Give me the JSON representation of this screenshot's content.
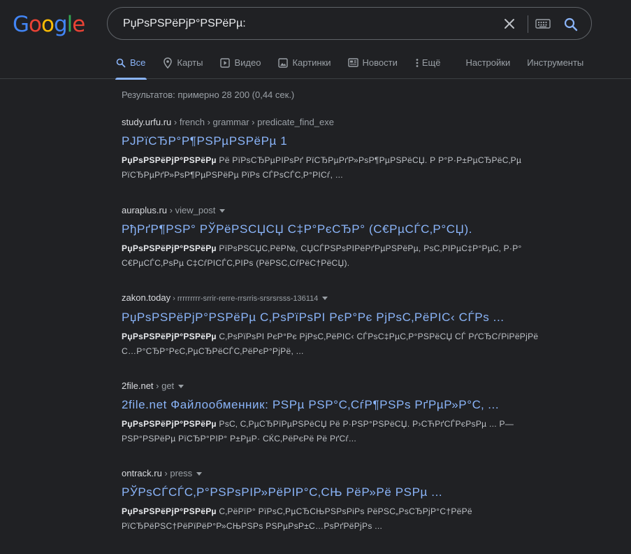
{
  "header": {
    "logo_letters": [
      "G",
      "o",
      "o",
      "g",
      "l",
      "e"
    ],
    "colors": {
      "blue": "#4285f4",
      "red": "#ea4335",
      "yellow": "#fbbc05",
      "green": "#34a853",
      "link": "#8ab4f8"
    }
  },
  "search": {
    "query": "РџРѕРЅРёРјР°РЅРёРµ:"
  },
  "icons": {
    "clear": "close-icon",
    "keyboard": "keyboard-icon",
    "search": "search-icon"
  },
  "tabs": [
    {
      "label": "Все",
      "icon": "search-icon"
    },
    {
      "label": "Карты",
      "icon": "map-pin-icon"
    },
    {
      "label": "Видео",
      "icon": "play-icon"
    },
    {
      "label": "Картинки",
      "icon": "image-icon"
    },
    {
      "label": "Новости",
      "icon": "news-icon"
    },
    {
      "label": "Ещё",
      "icon": "more-vert-icon"
    },
    {
      "label": "Настройки"
    },
    {
      "label": "Инструменты"
    }
  ],
  "stats": "Результатов: примерно 28 200 (0,44 сек.)",
  "results": [
    {
      "domain": "study.urfu.ru",
      "path": " › french › grammar › predicate_find_exe",
      "has_menu": false,
      "title": "РЈРїСЂР°Р¶РЅРµРЅРёРµ 1",
      "snippet_bold": "РџРѕРЅРёРјР°РЅРёРµ",
      "snippet": " Рё РїРѕСЂРµРІРѕРґ РїСЂРµРґР»РѕР¶РµРЅРёСЏ. Р Р°Р·Р±РµСЂРёС‚Рµ РїСЂРµРґР»РѕР¶РµРЅРёРµ РїРѕ СЃРѕСЃС‚Р°РІСѓ, ..."
    },
    {
      "domain": "auraplus.ru",
      "path": " › view_post",
      "has_menu": true,
      "title": "РђРґР¶РЅР° РЎРёРЅСЏСЏ С‡Р°РєСЂР° (С€РµСЃС‚Р°СЏ).",
      "snippet_bold": "РџРѕРЅРёРјР°РЅРёРµ",
      "snippet": " РїРѕРЅСЏС‚РёР№, СЏСЃРЅРѕРІРёРґРµРЅРёРµ, РѕС‚РІРµС‡Р°РµС‚ Р·Р° С€РµСЃС‚РѕРµ С‡СѓРІСЃС‚РІРѕ (РёРЅС‚СѓРёС†РёСЏ)."
    },
    {
      "domain": "zakon.today",
      "path": " › rrrrrrrrr-srrir-rerre-rrsrris-srsrsrsss-136114",
      "has_menu": true,
      "title": "РџРѕРЅРёРјР°РЅРёРµ С‚РѕРїРѕРІ РєР°Рє РјРѕС‚РёРІС‹ СЃРѕ ...",
      "snippet_bold": "РџРѕРЅРёРјР°РЅРёРµ",
      "snippet": " С‚РѕРїРѕРІ РєР°Рє РјРѕС‚РёРІС‹ СЃРѕС‡РµС‚Р°РЅРёСЏ СЃ РґСЂСѓРіРёРјРё С…Р°СЂР°РєС‚РµСЂРёСЃС‚РёРєР°РјРё, ..."
    },
    {
      "domain": "2file.net",
      "path": " › get",
      "has_menu": true,
      "title": "2file.net Файлообменник: РЅРµ РЅР°С‚СѓР¶РЅРѕ РґРµР»Р°С‚ ...",
      "snippet_bold": "РџРѕРЅРёРјР°РЅРёРµ",
      "snippet": " РѕС‚ С‚РµСЂРїРµРЅРёСЏ Рё Р·РЅР°РЅРёСЏ. Р›СЋРґСЃРєРѕРµ ... Р—РЅР°РЅРёРµ РїСЂР°РІР° Р±РµР· СЌС‚РёРєРё Рё РґСѓ..."
    },
    {
      "domain": "ontrack.ru",
      "path": " › press",
      "has_menu": true,
      "title": "РЎРѕСЃСЃС‚Р°РЅРѕРІР»РёРІР°С‚СЊ РёР»Рё РЅРµ ...",
      "snippet_bold": "РџРѕРЅРёРјР°РЅРёРµ",
      "snippet": " С‚РёРїР° РїРѕС‚РµСЂСЊРЅРѕРіРѕ РёРЅС„РѕСЂРјР°С†РёРё РїСЂРёРЅС†РёРїРёР°Р»СЊРЅРѕ РЅРµРѕР±С…РѕРґРёРјРѕ ..."
    }
  ]
}
